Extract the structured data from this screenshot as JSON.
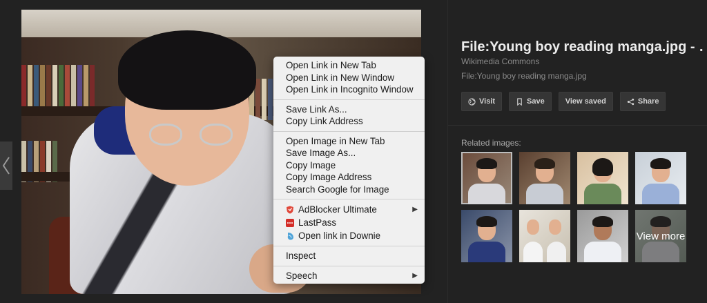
{
  "menu": {
    "group1": [
      "Open Link in New Tab",
      "Open Link in New Window",
      "Open Link in Incognito Window"
    ],
    "group2": [
      "Save Link As...",
      "Copy Link Address"
    ],
    "group3": [
      "Open Image in New Tab",
      "Save Image As...",
      "Copy Image",
      "Copy Image Address",
      "Search Google for Image"
    ],
    "extensions": [
      {
        "label": "AdBlocker Ultimate",
        "icon": "shield-icon",
        "color": "#e0483a",
        "submenu": true
      },
      {
        "label": "LastPass",
        "icon": "lastpass-icon",
        "color": "#d32d27",
        "submenu": false
      },
      {
        "label": "Open link in Downie",
        "icon": "downie-icon",
        "color": "#4fa3d8",
        "submenu": false
      }
    ],
    "inspect": "Inspect",
    "speech": "Speech",
    "submenu_arrow": "▶"
  },
  "panel": {
    "title": "File:Young boy reading manga.jpg - …",
    "source": "Wikimedia Commons",
    "filename": "File:Young boy reading manga.jpg",
    "buttons": {
      "visit": "Visit",
      "save": "Save",
      "view_saved": "View saved",
      "share": "Share"
    },
    "related_label": "Related images:",
    "view_more": "View more"
  },
  "colors": {
    "background": "#222222",
    "menu_bg": "#f0f0f0",
    "button_bg": "#353535",
    "title_text": "#ececec",
    "muted_text": "#8a8a8a"
  }
}
